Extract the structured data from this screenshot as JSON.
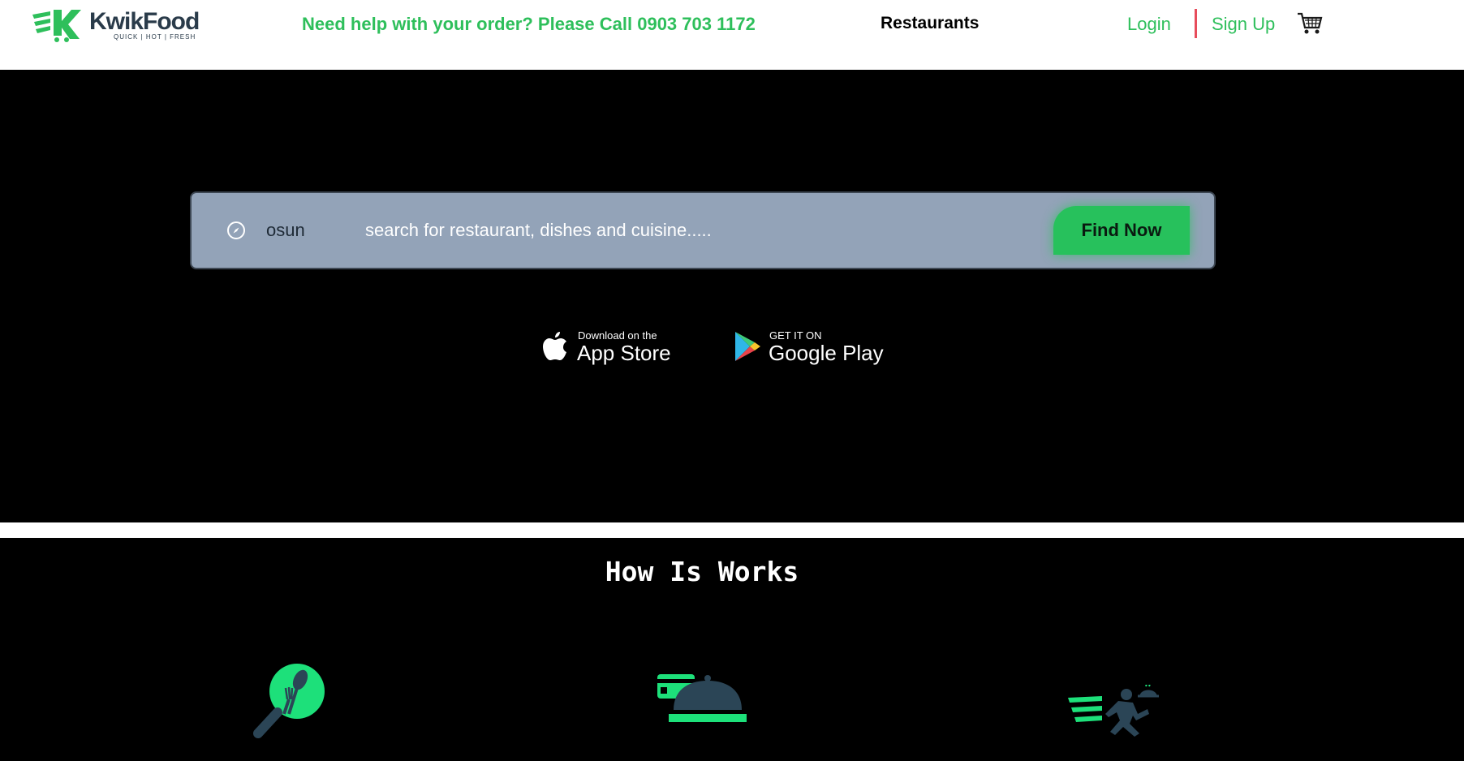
{
  "header": {
    "logo_name": "KwikFood",
    "logo_tagline": "QUICK | HOT | FRESH",
    "help_text": "Need help with your order? Please Call 0903 703 1172",
    "nav": {
      "restaurants": "Restaurants",
      "login": "Login",
      "signup": "Sign Up"
    },
    "cart_icon": "cart-icon"
  },
  "search": {
    "location_icon": "compass-icon",
    "location_value": "osun",
    "query_placeholder": "search for restaurant, dishes and cuisine.....",
    "button_label": "Find Now"
  },
  "stores": {
    "appstore_small": "Download on the",
    "appstore_big": "App Store",
    "googleplay_small": "GET IT ON",
    "googleplay_big": "Google Play"
  },
  "how_it_works": {
    "title": "How Is Works",
    "steps": [
      {
        "icon": "search-food-icon"
      },
      {
        "icon": "payment-dish-icon"
      },
      {
        "icon": "delivery-runner-icon"
      }
    ]
  },
  "colors": {
    "brand_green": "#2ebf5b",
    "button_green": "#27c15c",
    "search_bg": "#93a3b8",
    "divider_red": "#e74c5b",
    "dark_navy": "#2a3b4a"
  }
}
